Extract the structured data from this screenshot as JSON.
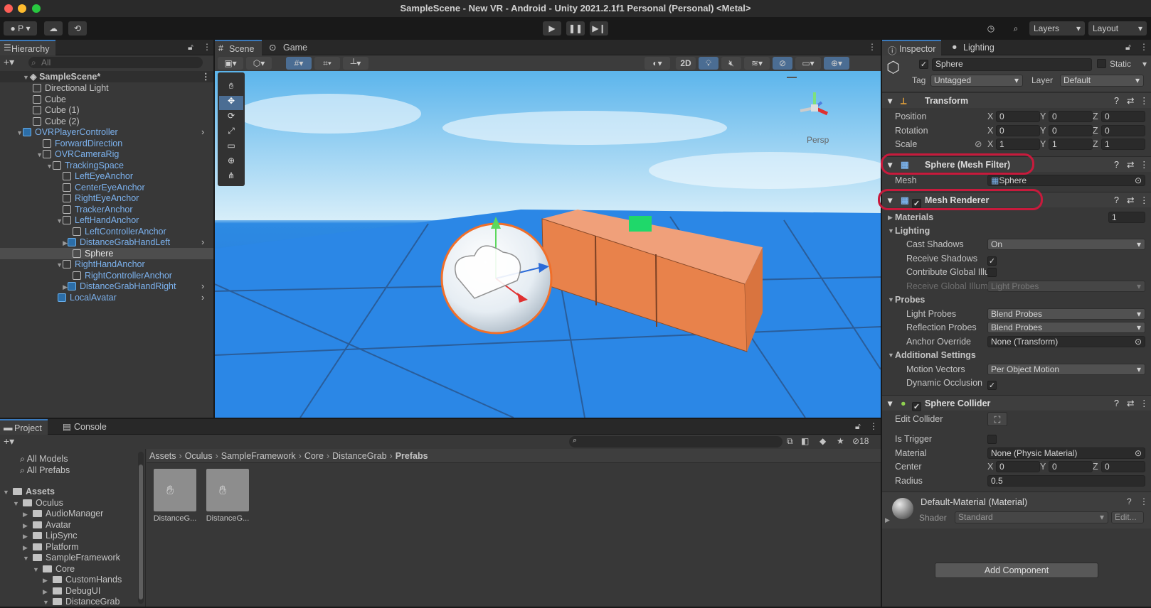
{
  "window": {
    "title": "SampleScene - New VR - Android - Unity 2021.2.1f1 Personal (Personal) <Metal>"
  },
  "toolbar": {
    "account": "P",
    "layers": "Layers",
    "layout": "Layout"
  },
  "hierarchy": {
    "tab": "Hierarchy",
    "search_placeholder": "All",
    "scene": "SampleScene*",
    "items": [
      {
        "label": "Directional Light"
      },
      {
        "label": "Cube"
      },
      {
        "label": "Cube (1)"
      },
      {
        "label": "Cube (2)"
      },
      {
        "label": "OVRPlayerController"
      },
      {
        "label": "ForwardDirection"
      },
      {
        "label": "OVRCameraRig"
      },
      {
        "label": "TrackingSpace"
      },
      {
        "label": "LeftEyeAnchor"
      },
      {
        "label": "CenterEyeAnchor"
      },
      {
        "label": "RightEyeAnchor"
      },
      {
        "label": "TrackerAnchor"
      },
      {
        "label": "LeftHandAnchor"
      },
      {
        "label": "LeftControllerAnchor"
      },
      {
        "label": "DistanceGrabHandLeft"
      },
      {
        "label": "Sphere"
      },
      {
        "label": "RightHandAnchor"
      },
      {
        "label": "RightControllerAnchor"
      },
      {
        "label": "DistanceGrabHandRight"
      },
      {
        "label": "LocalAvatar"
      }
    ]
  },
  "scene": {
    "tab_scene": "Scene",
    "tab_game": "Game",
    "btn_2d": "2D",
    "persp": "Persp"
  },
  "inspector": {
    "tab_inspector": "Inspector",
    "tab_lighting": "Lighting",
    "name": "Sphere",
    "static_label": "Static",
    "tag_label": "Tag",
    "tag_value": "Untagged",
    "layer_label": "Layer",
    "layer_value": "Default",
    "transform": {
      "title": "Transform",
      "position": {
        "label": "Position",
        "x": "0",
        "y": "0",
        "z": "0"
      },
      "rotation": {
        "label": "Rotation",
        "x": "0",
        "y": "0",
        "z": "0"
      },
      "scale": {
        "label": "Scale",
        "x": "1",
        "y": "1",
        "z": "1"
      }
    },
    "axis": {
      "x": "X",
      "y": "Y",
      "z": "Z"
    },
    "mesh_filter": {
      "title": "Sphere (Mesh Filter)",
      "mesh_label": "Mesh",
      "mesh_value": "Sphere"
    },
    "mesh_renderer": {
      "title": "Mesh Renderer",
      "materials_label": "Materials",
      "materials_count": "1",
      "lighting": "Lighting",
      "cast_shadows": "Cast Shadows",
      "cast_shadows_value": "On",
      "receive_shadows": "Receive Shadows",
      "contribute_gi": "Contribute Global Illu",
      "receive_gi": "Receive Global Illum",
      "receive_gi_value": "Light Probes",
      "probes": "Probes",
      "light_probes": "Light Probes",
      "light_probes_value": "Blend Probes",
      "reflection_probes": "Reflection Probes",
      "reflection_probes_value": "Blend Probes",
      "anchor_override": "Anchor Override",
      "anchor_override_value": "None (Transform)",
      "additional": "Additional Settings",
      "motion_vectors": "Motion Vectors",
      "motion_vectors_value": "Per Object Motion",
      "dynamic_occlusion": "Dynamic Occlusion"
    },
    "sphere_collider": {
      "title": "Sphere Collider",
      "edit_collider": "Edit Collider",
      "is_trigger": "Is Trigger",
      "material": "Material",
      "material_value": "None (Physic Material)",
      "center": "Center",
      "cx": "0",
      "cy": "0",
      "cz": "0",
      "radius": "Radius",
      "radius_value": "0.5"
    },
    "material": {
      "name": "Default-Material (Material)",
      "shader_label": "Shader",
      "shader_value": "Standard",
      "edit": "Edit..."
    },
    "add_component": "Add Component"
  },
  "project": {
    "tab_project": "Project",
    "tab_console": "Console",
    "hidden_count": "18",
    "favorites": [
      "All Models",
      "All Prefabs"
    ],
    "tree": [
      {
        "label": "Assets"
      },
      {
        "label": "Oculus"
      },
      {
        "label": "AudioManager"
      },
      {
        "label": "Avatar"
      },
      {
        "label": "LipSync"
      },
      {
        "label": "Platform"
      },
      {
        "label": "SampleFramework"
      },
      {
        "label": "Core"
      },
      {
        "label": "CustomHands"
      },
      {
        "label": "DebugUI"
      },
      {
        "label": "DistanceGrab"
      }
    ],
    "breadcrumb": [
      "Assets",
      "Oculus",
      "SampleFramework",
      "Core",
      "DistanceGrab",
      "Prefabs"
    ],
    "assets": [
      {
        "label": "DistanceG..."
      },
      {
        "label": "DistanceG..."
      }
    ]
  },
  "colors": {
    "accent": "#3a79bb",
    "highlight": "#c81a3c",
    "prefab_blue": "#7cb2ee"
  }
}
